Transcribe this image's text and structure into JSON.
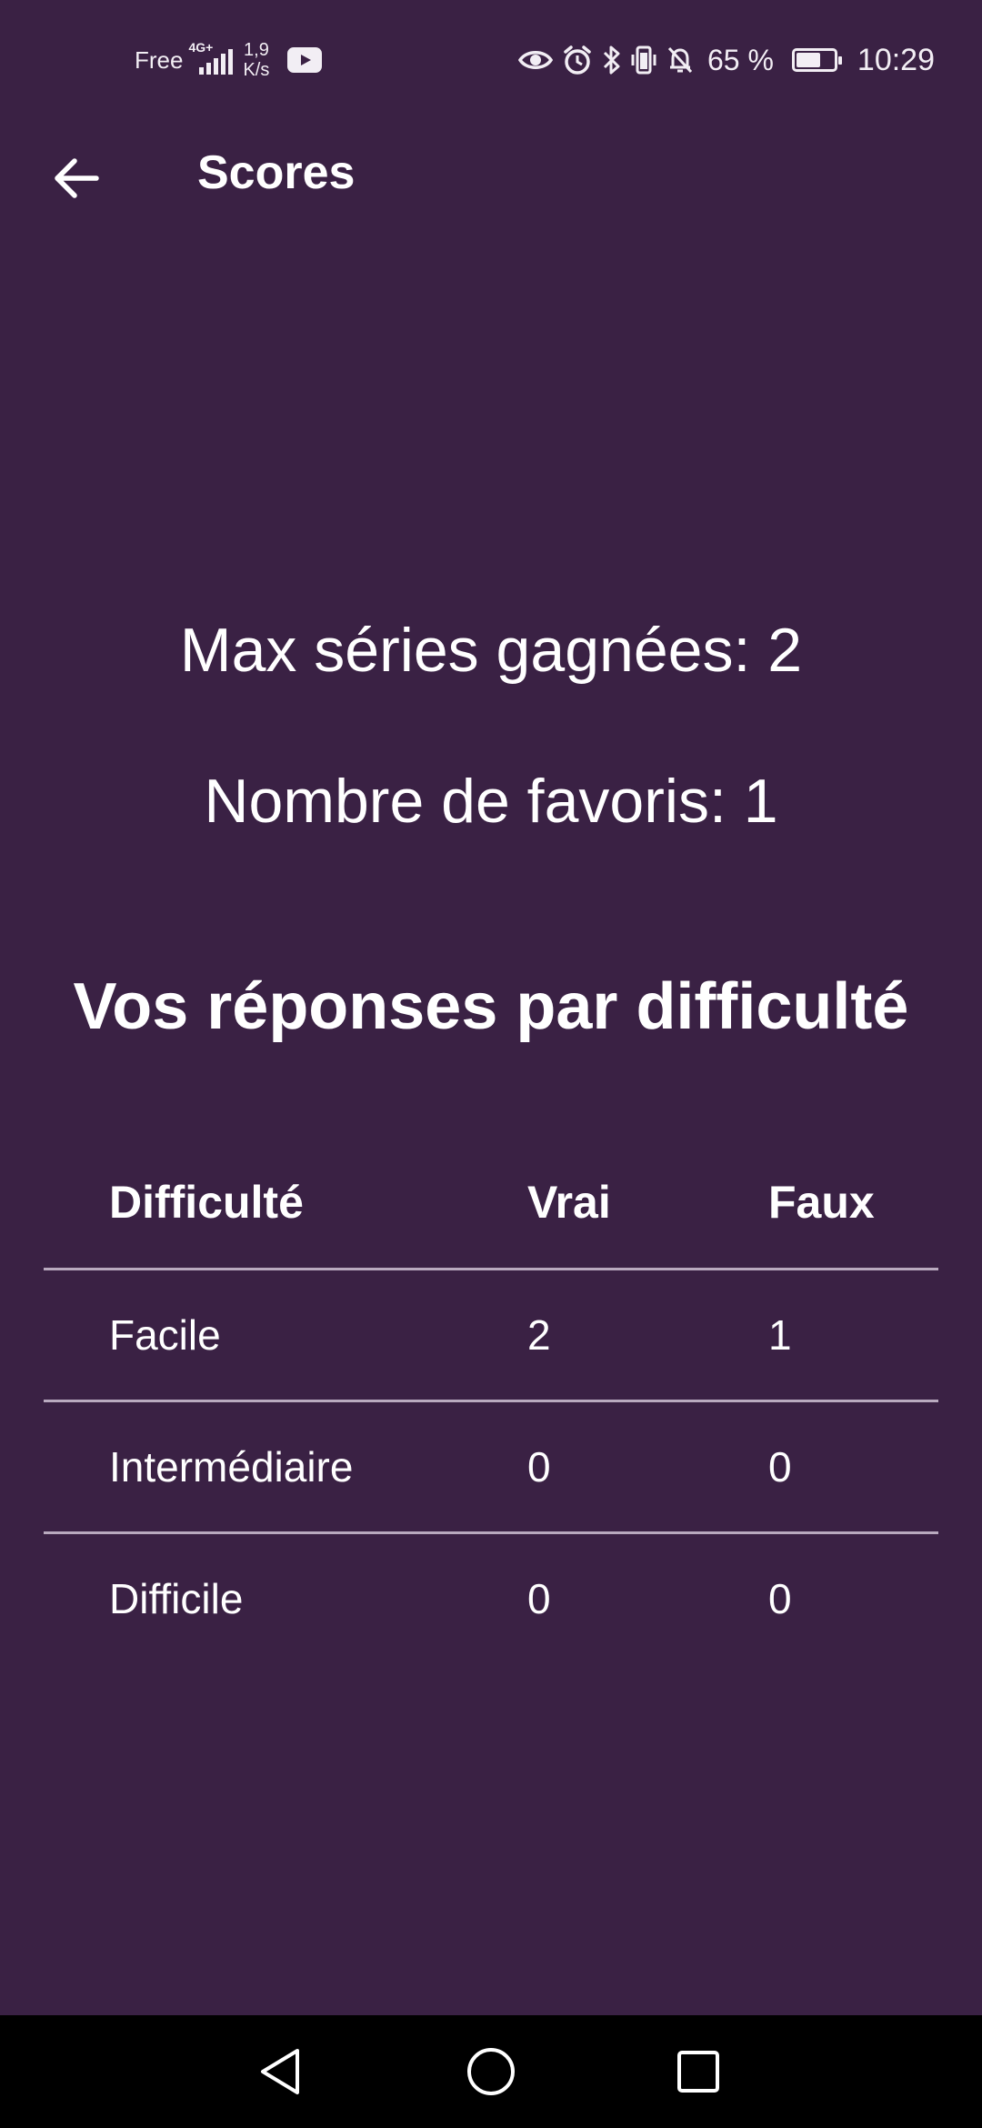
{
  "status_bar": {
    "carrier": "Free",
    "network_type": "4G+",
    "speed_value": "1,9",
    "speed_unit": "K/s",
    "battery_percent": "65 %",
    "battery_level": 0.65,
    "time": "10:29",
    "icons": [
      "signal-icon",
      "youtube-icon",
      "eye-icon",
      "alarm-icon",
      "bluetooth-icon",
      "vibrate-icon",
      "notifications-off-icon",
      "battery-icon"
    ]
  },
  "app_bar": {
    "title": "Scores",
    "back_icon": "arrow-back-icon"
  },
  "stats": {
    "max_streak": "Max séries gagnées: 2",
    "favorites": "Nombre de favoris: 1"
  },
  "section": {
    "title": "Vos réponses par difficulté"
  },
  "table": {
    "headers": [
      "Difficulté",
      "Vrai",
      "Faux"
    ],
    "rows": [
      [
        "Facile",
        "2",
        "1"
      ],
      [
        "Intermédiaire",
        "0",
        "0"
      ],
      [
        "Difficile",
        "0",
        "0"
      ]
    ]
  },
  "nav_bar": {
    "icons": [
      "nav-back-icon",
      "nav-home-icon",
      "nav-recents-icon"
    ]
  },
  "colors": {
    "background": "#3a2144",
    "text": "#ffffff",
    "divider": "#b9aabf",
    "nav_bar": "#000000"
  }
}
